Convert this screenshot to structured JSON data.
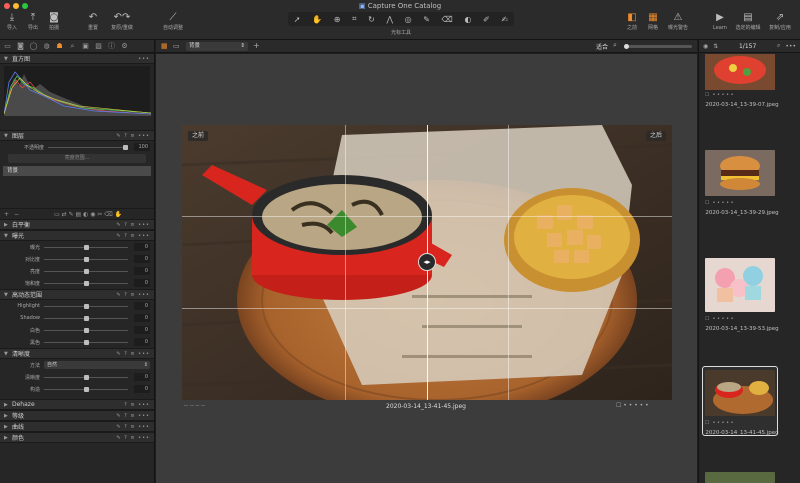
{
  "window": {
    "title": "Capture One Catalog"
  },
  "toolbar": {
    "import": "导入",
    "export": "导出",
    "capture": "拍摄",
    "reset": "重置",
    "undo_redo": "复原/重做",
    "auto_adjust": "自动调整",
    "cursor_tools": "光标工具",
    "before": "之前",
    "grid": "网格",
    "exposure_warning": "曝光警告",
    "learn": "Learn",
    "selected_edits": "选定的编辑",
    "copy_apply": "复制/应用"
  },
  "left": {
    "histogram": {
      "title": "直方图"
    },
    "layers": {
      "title": "图层",
      "opacity_label": "不透明度",
      "opacity_value": "100",
      "brush_range": "亮度范围...",
      "bg_layer": "背景"
    },
    "sections": {
      "white_balance": "白平衡",
      "exposure": "曝光",
      "hdr": "高动态范围",
      "clarity": "清晰度",
      "dehaze": "Dehaze",
      "levels": "等级",
      "curve": "曲线",
      "color": "颜色"
    },
    "exposure_rows": [
      {
        "name": "曝光",
        "value": "0"
      },
      {
        "name": "对比度",
        "value": "0"
      },
      {
        "name": "亮度",
        "value": "0"
      },
      {
        "name": "饱和度",
        "value": "0"
      }
    ],
    "hdr_rows": [
      {
        "name": "Highlight",
        "value": "0"
      },
      {
        "name": "Shadow",
        "value": "0"
      },
      {
        "name": "白色",
        "value": "0"
      },
      {
        "name": "黑色",
        "value": "0"
      }
    ],
    "clarity": {
      "method_label": "方法",
      "method_value": "自然",
      "rows": [
        {
          "name": "清晰度",
          "value": "0"
        },
        {
          "name": "构造",
          "value": "0"
        }
      ]
    }
  },
  "center": {
    "layer_select": "背景",
    "fit": "适合",
    "before_tag": "之前",
    "after_tag": "之后",
    "filename": "2020-03-14_13-41-45.jpeg",
    "left_meta": "--  --  --  --"
  },
  "browser": {
    "counter": "1/157",
    "thumbs": [
      {
        "file": "2020-03-14_13-39-07.jpeg"
      },
      {
        "file": "2020-03-14_13-39-29.jpeg"
      },
      {
        "file": "2020-03-14_13-39-53.jpeg"
      },
      {
        "file": "2020-03-14_13-41-45.jpeg"
      }
    ]
  },
  "colors": {
    "accent": "#f08c2b",
    "panel": "#262626",
    "viewer": "#3c3c3c"
  }
}
